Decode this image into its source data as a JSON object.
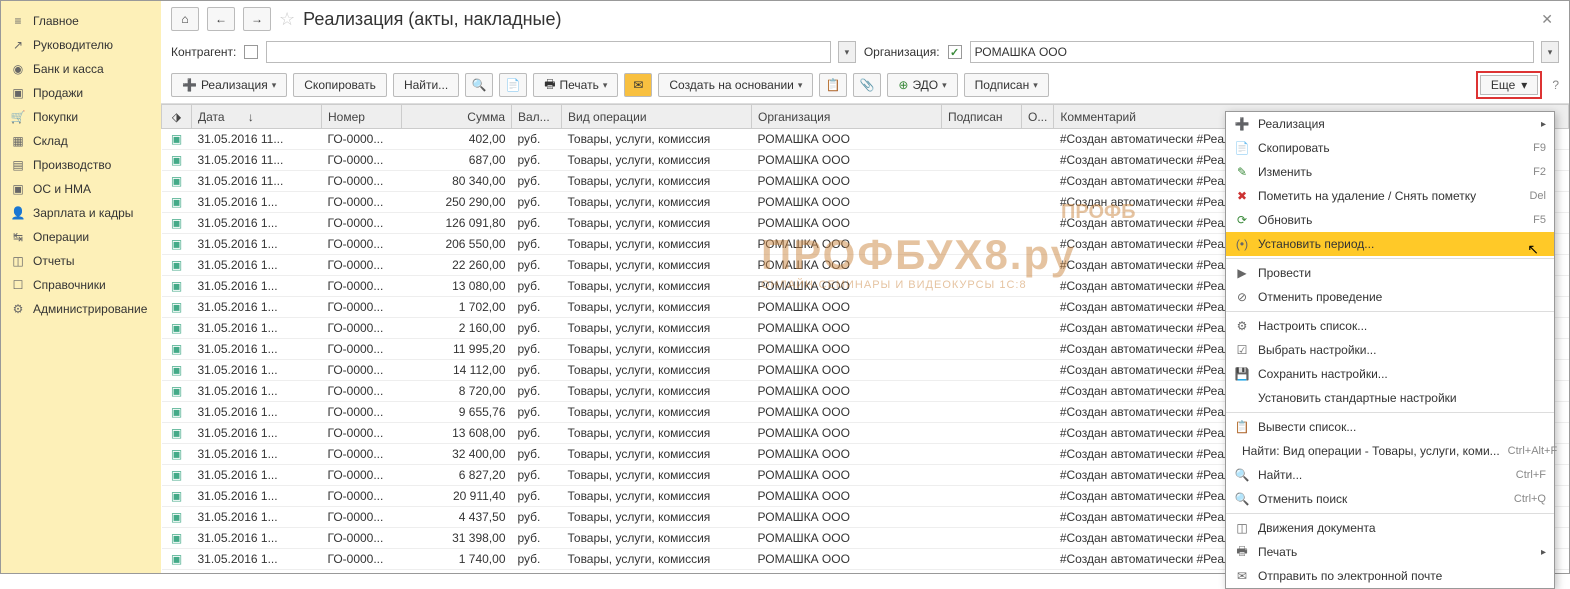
{
  "sidebar": {
    "items": [
      {
        "label": "Главное",
        "icon": "≡"
      },
      {
        "label": "Руководителю",
        "icon": "↗"
      },
      {
        "label": "Банк и касса",
        "icon": "◉"
      },
      {
        "label": "Продажи",
        "icon": "▣"
      },
      {
        "label": "Покупки",
        "icon": "🛒"
      },
      {
        "label": "Склад",
        "icon": "▦"
      },
      {
        "label": "Производство",
        "icon": "▤"
      },
      {
        "label": "ОС и НМА",
        "icon": "▣"
      },
      {
        "label": "Зарплата и кадры",
        "icon": "👤"
      },
      {
        "label": "Операции",
        "icon": "↹"
      },
      {
        "label": "Отчеты",
        "icon": "◫"
      },
      {
        "label": "Справочники",
        "icon": "☐"
      },
      {
        "label": "Администрирование",
        "icon": "⚙"
      }
    ]
  },
  "header": {
    "title": "Реализация (акты, накладные)"
  },
  "filter": {
    "counterparty_label": "Контрагент:",
    "counterparty_value": "",
    "org_label": "Организация:",
    "org_value": "РОМАШКА ООО"
  },
  "toolbar": {
    "realizaciya": "Реализация",
    "copy": "Скопировать",
    "find": "Найти...",
    "print": "Печать",
    "create_based": "Создать на основании",
    "edo": "ЭДО",
    "signed": "Подписан",
    "more": "Еще"
  },
  "table": {
    "headers": {
      "date": "Дата",
      "number": "Номер",
      "sum": "Сумма",
      "currency": "Вал...",
      "op_type": "Вид операции",
      "org": "Организация",
      "signed": "Подписан",
      "o": "О...",
      "comment": "Комментарий"
    },
    "rows": [
      {
        "date": "31.05.2016 11...",
        "number": "ГО-0000...",
        "sum": "402,00",
        "cur": "руб.",
        "op": "Товары, услуги, комиссия",
        "org": "РОМАШКА ООО",
        "comment": "#Создан автоматически #Реализация N..."
      },
      {
        "date": "31.05.2016 11...",
        "number": "ГО-0000...",
        "sum": "687,00",
        "cur": "руб.",
        "op": "Товары, услуги, комиссия",
        "org": "РОМАШКА ООО",
        "comment": "#Создан автоматически #Реализация N..."
      },
      {
        "date": "31.05.2016 11...",
        "number": "ГО-0000...",
        "sum": "80 340,00",
        "cur": "руб.",
        "op": "Товары, услуги, комиссия",
        "org": "РОМАШКА ООО",
        "comment": "#Создан автоматически #Реализация N..."
      },
      {
        "date": "31.05.2016 1...",
        "number": "ГО-0000...",
        "sum": "250 290,00",
        "cur": "руб.",
        "op": "Товары, услуги, комиссия",
        "org": "РОМАШКА ООО",
        "comment": "#Создан автоматически #Реализация N..."
      },
      {
        "date": "31.05.2016 1...",
        "number": "ГО-0000...",
        "sum": "126 091,80",
        "cur": "руб.",
        "op": "Товары, услуги, комиссия",
        "org": "РОМАШКА ООО",
        "comment": "#Создан автоматически #Реализация N..."
      },
      {
        "date": "31.05.2016 1...",
        "number": "ГО-0000...",
        "sum": "206 550,00",
        "cur": "руб.",
        "op": "Товары, услуги, комиссия",
        "org": "РОМАШКА ООО",
        "comment": "#Создан автоматически #Реализация N..."
      },
      {
        "date": "31.05.2016 1...",
        "number": "ГО-0000...",
        "sum": "22 260,00",
        "cur": "руб.",
        "op": "Товары, услуги, комиссия",
        "org": "РОМАШКА ООО",
        "comment": "#Создан автоматически #Реализация N..."
      },
      {
        "date": "31.05.2016 1...",
        "number": "ГО-0000...",
        "sum": "13 080,00",
        "cur": "руб.",
        "op": "Товары, услуги, комиссия",
        "org": "РОМАШКА ООО",
        "comment": "#Создан автоматически #Реализация N..."
      },
      {
        "date": "31.05.2016 1...",
        "number": "ГО-0000...",
        "sum": "1 702,00",
        "cur": "руб.",
        "op": "Товары, услуги, комиссия",
        "org": "РОМАШКА ООО",
        "comment": "#Создан автоматически #Реализация N..."
      },
      {
        "date": "31.05.2016 1...",
        "number": "ГО-0000...",
        "sum": "2 160,00",
        "cur": "руб.",
        "op": "Товары, услуги, комиссия",
        "org": "РОМАШКА ООО",
        "comment": "#Создан автоматически #Реализация N..."
      },
      {
        "date": "31.05.2016 1...",
        "number": "ГО-0000...",
        "sum": "11 995,20",
        "cur": "руб.",
        "op": "Товары, услуги, комиссия",
        "org": "РОМАШКА ООО",
        "comment": "#Создан автоматически #Реализация N..."
      },
      {
        "date": "31.05.2016 1...",
        "number": "ГО-0000...",
        "sum": "14 112,00",
        "cur": "руб.",
        "op": "Товары, услуги, комиссия",
        "org": "РОМАШКА ООО",
        "comment": "#Создан автоматически #Реализация N..."
      },
      {
        "date": "31.05.2016 1...",
        "number": "ГО-0000...",
        "sum": "8 720,00",
        "cur": "руб.",
        "op": "Товары, услуги, комиссия",
        "org": "РОМАШКА ООО",
        "comment": "#Создан автоматически #Реализация N..."
      },
      {
        "date": "31.05.2016 1...",
        "number": "ГО-0000...",
        "sum": "9 655,76",
        "cur": "руб.",
        "op": "Товары, услуги, комиссия",
        "org": "РОМАШКА ООО",
        "comment": "#Создан автоматически #Реализация N..."
      },
      {
        "date": "31.05.2016 1...",
        "number": "ГО-0000...",
        "sum": "13 608,00",
        "cur": "руб.",
        "op": "Товары, услуги, комиссия",
        "org": "РОМАШКА ООО",
        "comment": "#Создан автоматически #Реализация N..."
      },
      {
        "date": "31.05.2016 1...",
        "number": "ГО-0000...",
        "sum": "32 400,00",
        "cur": "руб.",
        "op": "Товары, услуги, комиссия",
        "org": "РОМАШКА ООО",
        "comment": "#Создан автоматически #Реализация N..."
      },
      {
        "date": "31.05.2016 1...",
        "number": "ГО-0000...",
        "sum": "6 827,20",
        "cur": "руб.",
        "op": "Товары, услуги, комиссия",
        "org": "РОМАШКА ООО",
        "comment": "#Создан автоматически #Реализация N..."
      },
      {
        "date": "31.05.2016 1...",
        "number": "ГО-0000...",
        "sum": "20 911,40",
        "cur": "руб.",
        "op": "Товары, услуги, комиссия",
        "org": "РОМАШКА ООО",
        "comment": "#Создан автоматически #Реализация N..."
      },
      {
        "date": "31.05.2016 1...",
        "number": "ГО-0000...",
        "sum": "4 437,50",
        "cur": "руб.",
        "op": "Товары, услуги, комиссия",
        "org": "РОМАШКА ООО",
        "comment": "#Создан автоматически #Реализация N..."
      },
      {
        "date": "31.05.2016 1...",
        "number": "ГО-0000...",
        "sum": "31 398,00",
        "cur": "руб.",
        "op": "Товары, услуги, комиссия",
        "org": "РОМАШКА ООО",
        "comment": "#Создан автоматически #Реализация N..."
      },
      {
        "date": "31.05.2016 1...",
        "number": "ГО-0000...",
        "sum": "1 740,00",
        "cur": "руб.",
        "op": "Товары, услуги, комиссия",
        "org": "РОМАШКА ООО",
        "comment": "#Создан автоматически #Реализация N..."
      }
    ]
  },
  "menu": {
    "items": [
      {
        "icon": "➕",
        "label": "Реализация",
        "sub": "▸",
        "color": "#3a8a3a"
      },
      {
        "icon": "📄",
        "label": "Скопировать",
        "shortcut": "F9"
      },
      {
        "icon": "✎",
        "label": "Изменить",
        "shortcut": "F2",
        "color": "#3a8a3a"
      },
      {
        "icon": "✖",
        "label": "Пометить на удаление / Снять пометку",
        "shortcut": "Del",
        "color": "#c33"
      },
      {
        "icon": "⟳",
        "label": "Обновить",
        "shortcut": "F5",
        "color": "#3a8a3a"
      },
      {
        "icon": "(•)",
        "label": "Установить период...",
        "highlight": true
      },
      {
        "sep": true
      },
      {
        "icon": "▶",
        "label": "Провести"
      },
      {
        "icon": "⊘",
        "label": "Отменить проведение"
      },
      {
        "sep": true
      },
      {
        "icon": "⚙",
        "label": "Настроить список..."
      },
      {
        "icon": "☑",
        "label": "Выбрать настройки..."
      },
      {
        "icon": "💾",
        "label": "Сохранить настройки..."
      },
      {
        "icon": "",
        "label": "Установить стандартные настройки"
      },
      {
        "sep": true
      },
      {
        "icon": "📋",
        "label": "Вывести список..."
      },
      {
        "icon": "",
        "label": "Найти: Вид операции - Товары, услуги, коми...",
        "shortcut": "Ctrl+Alt+F"
      },
      {
        "icon": "🔍",
        "label": "Найти...",
        "shortcut": "Ctrl+F"
      },
      {
        "icon": "🔍",
        "label": "Отменить поиск",
        "shortcut": "Ctrl+Q"
      },
      {
        "sep": true
      },
      {
        "icon": "◫",
        "label": "Движения документа"
      },
      {
        "icon": "🖶",
        "label": "Печать",
        "sub": "▸"
      },
      {
        "icon": "✉",
        "label": "Отправить по электронной почте"
      }
    ]
  },
  "watermark": {
    "line1": "ПРОФБУХ8.ру",
    "line2": "ОНЛАЙН-СЕМИНАРЫ И ВИДЕОКУРСЫ 1С:8",
    "badge": "ПРОФБ"
  }
}
